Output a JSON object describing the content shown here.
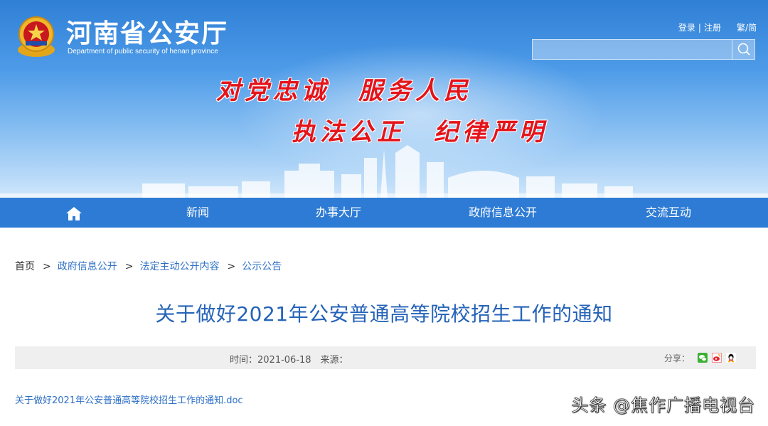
{
  "header": {
    "title": "河南省公安厅",
    "subtitle": "Department of public security of henan province",
    "login": "登录",
    "divider": "|",
    "register": "注册",
    "trad_simp": "繁/简",
    "search_placeholder": ""
  },
  "banner": {
    "slogan_line1": "对党忠诚　服务人民",
    "slogan_line2": "执法公正　纪律严明"
  },
  "nav": {
    "items": [
      {
        "label": "新闻"
      },
      {
        "label": "办事大厅"
      },
      {
        "label": "政府信息公开"
      },
      {
        "label": "交流互动"
      }
    ]
  },
  "breadcrumb": {
    "home": "首页",
    "sep": ">",
    "items": [
      "政府信息公开",
      "法定主动公开内容",
      "公示公告"
    ]
  },
  "article": {
    "title": "关于做好2021年公安普通高等院校招生工作的通知",
    "meta": "时间：2021-06-18　来源：",
    "share_label": "分享：",
    "attachment": "关于做好2021年公安普通高等院校招生工作的通知.doc"
  },
  "watermark": "头条 @焦作广播电视台",
  "colors": {
    "nav_bg": "#2d7bd4",
    "title_blue": "#2563b8",
    "slogan_red": "#e4141b",
    "link_blue": "#2d6fc6"
  },
  "icons": [
    "home-icon",
    "search-icon",
    "police-emblem",
    "wechat-share-icon",
    "weibo-share-icon",
    "qq-share-icon"
  ]
}
